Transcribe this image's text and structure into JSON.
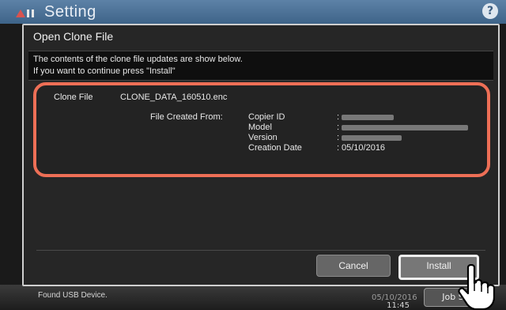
{
  "app": {
    "title": "Setting",
    "help_label": "?",
    "status_message": "Found USB Device.",
    "time_date": "05/10/2016",
    "time_clock": "11:45",
    "job_status_label": "Job S",
    "arrow_glyph": "▸"
  },
  "dialog": {
    "title": "Open Clone File",
    "message_line1": "The contents of the clone file updates are show below.",
    "message_line2": "If you want to continue press \"Install\"",
    "clone_file_label": "Clone File",
    "clone_file_value": "CLONE_DATA_160510.enc",
    "file_created_from_label": "File Created From:",
    "fields": [
      {
        "label": "Copier ID",
        "colon": ":"
      },
      {
        "label": "Model",
        "colon": ":"
      },
      {
        "label": "Version",
        "colon": ":"
      },
      {
        "label": "Creation Date",
        "colon": ":",
        "value": "05/10/2016"
      }
    ],
    "cancel_label": "Cancel",
    "install_label": "Install"
  },
  "colors": {
    "highlight": "#ee6f56",
    "header_blue": "#4d739a"
  }
}
